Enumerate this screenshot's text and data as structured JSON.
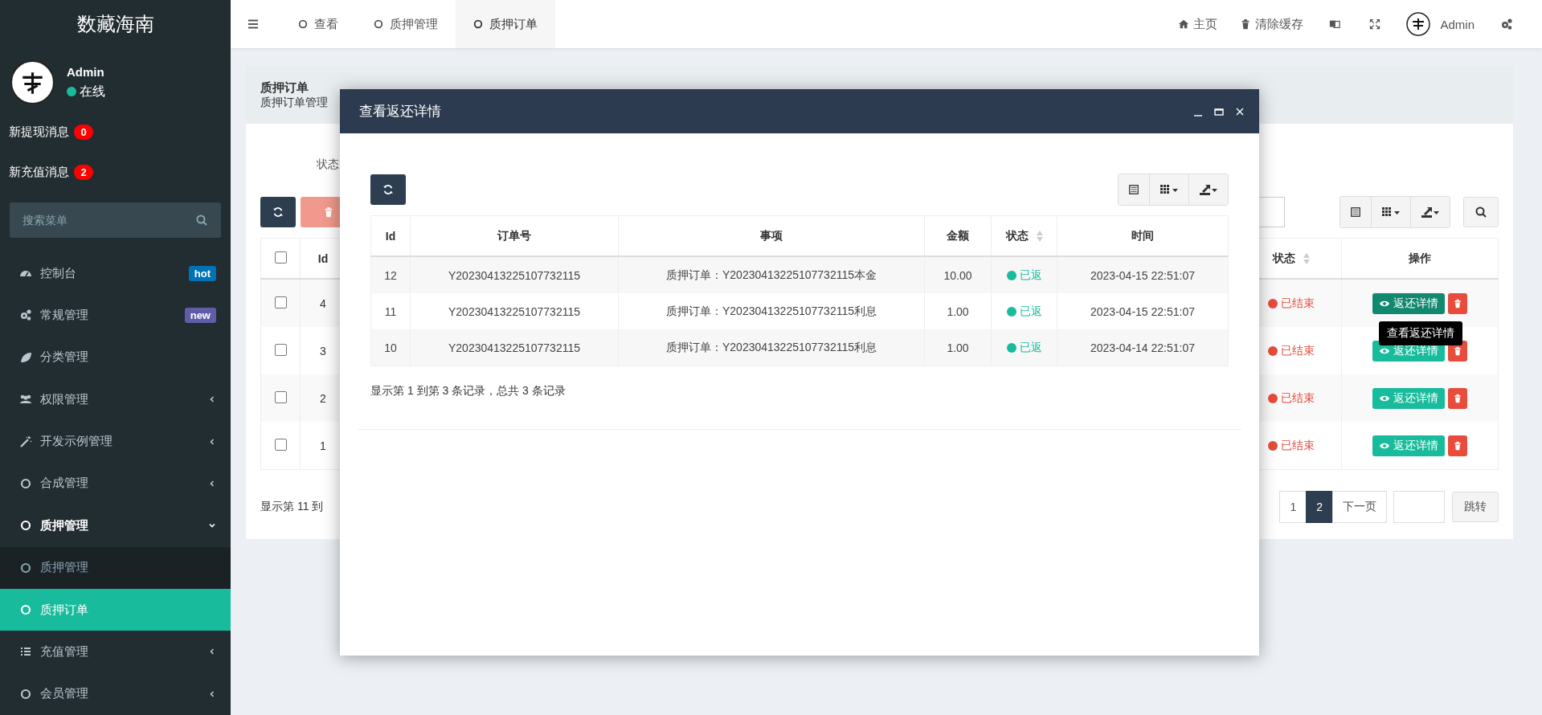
{
  "sidebar": {
    "title": "数藏海南",
    "user": {
      "name": "Admin",
      "status": "在线",
      "online": true
    },
    "notices": [
      {
        "label": "新提现消息",
        "count": "0"
      },
      {
        "label": "新充值消息",
        "count": "2"
      }
    ],
    "search": {
      "placeholder": "搜索菜单"
    },
    "menu": [
      {
        "label": "控制台",
        "badge": {
          "text": "hot",
          "color": "#0073b7"
        },
        "expandable": false,
        "expanded": false,
        "selected": false
      },
      {
        "label": "常规管理",
        "badge": {
          "text": "new",
          "color": "#605ca8"
        },
        "expandable": false,
        "expanded": false,
        "selected": false
      },
      {
        "label": "分类管理",
        "expandable": false,
        "expanded": false,
        "selected": false
      },
      {
        "label": "权限管理",
        "expandable": true,
        "expanded": false,
        "selected": false
      },
      {
        "label": "开发示例管理",
        "expandable": true,
        "expanded": false,
        "selected": false
      },
      {
        "label": "合成管理",
        "expandable": true,
        "expanded": false,
        "selected": false
      },
      {
        "label": "质押管理",
        "expandable": true,
        "expanded": true,
        "selected": false,
        "children": [
          {
            "label": "质押管理",
            "selected": false
          },
          {
            "label": "质押订单",
            "selected": true
          }
        ]
      },
      {
        "label": "充值管理",
        "expandable": true,
        "expanded": false,
        "selected": false
      },
      {
        "label": "会员管理",
        "expandable": true,
        "expanded": false,
        "selected": false
      }
    ]
  },
  "topbar": {
    "tabs": [
      {
        "label": "查看",
        "selected": false
      },
      {
        "label": "质押管理",
        "selected": false
      },
      {
        "label": "质押订单",
        "selected": true
      }
    ],
    "home": "主页",
    "clear_cache": "清除缓存",
    "user": "Admin"
  },
  "page": {
    "title": "质押订单",
    "subtitle": "质押订单管理",
    "filter_label": "状态",
    "table": {
      "columns": [
        "Id",
        "状态",
        "操作"
      ],
      "all_checked": false,
      "rows": [
        {
          "checked": false,
          "id": "4",
          "status": "已结束",
          "action": "返还详情",
          "hovered": true
        },
        {
          "checked": false,
          "id": "3",
          "status": "已结束",
          "action": "返还详情",
          "hovered": false
        },
        {
          "checked": false,
          "id": "2",
          "status": "已结束",
          "action": "返还详情",
          "hovered": false
        },
        {
          "checked": false,
          "id": "1",
          "status": "已结束",
          "action": "返还详情",
          "hovered": false
        }
      ]
    },
    "summary": "显示第 11 到",
    "pages": [
      {
        "label": "1",
        "selected": false
      },
      {
        "label": "2",
        "selected": true
      }
    ],
    "next": "下一页",
    "jump": "跳转"
  },
  "dialog": {
    "title": "查看返还详情",
    "columns": [
      "Id",
      "订单号",
      "事项",
      "金额",
      "状态",
      "时间"
    ],
    "rows": [
      {
        "id": "12",
        "order": "Y20230413225107732115",
        "item": "质押订单：Y20230413225107732115本金",
        "amount": "10.00",
        "status": "已返",
        "time": "2023-04-15 22:51:07"
      },
      {
        "id": "11",
        "order": "Y20230413225107732115",
        "item": "质押订单：Y20230413225107732115利息",
        "amount": "1.00",
        "status": "已返",
        "time": "2023-04-15 22:51:07"
      },
      {
        "id": "10",
        "order": "Y20230413225107732115",
        "item": "质押订单：Y20230413225107732115利息",
        "amount": "1.00",
        "status": "已返",
        "time": "2023-04-14 22:51:07"
      }
    ],
    "summary": "显示第 1 到第 3 条记录，总共 3 条记录"
  },
  "tooltip": "查看返还详情"
}
